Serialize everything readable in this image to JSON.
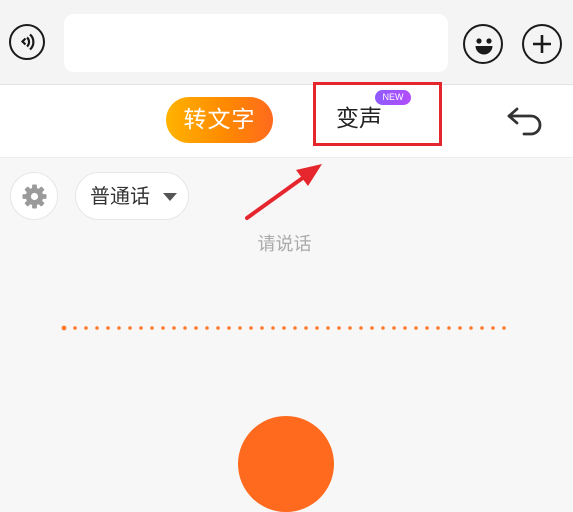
{
  "input_bar": {
    "message_value": ""
  },
  "tabs": {
    "convert_label": "转文字",
    "voice_change_label": "变声",
    "new_badge": "NEW"
  },
  "controls": {
    "language_label": "普通话"
  },
  "voice_panel": {
    "hint": "请说话"
  },
  "icons": {
    "voice": "voice-mode-icon",
    "emoji": "emoji-icon",
    "plus": "plus-icon",
    "back": "back-icon",
    "settings": "gear-icon",
    "dropdown": "caret-down-icon",
    "mic": "record-button"
  },
  "colors": {
    "accent_start": "#ffb300",
    "accent_end": "#ff6a1e",
    "annotation_red": "#e5262d",
    "badge_purple": "#8e5bff"
  }
}
